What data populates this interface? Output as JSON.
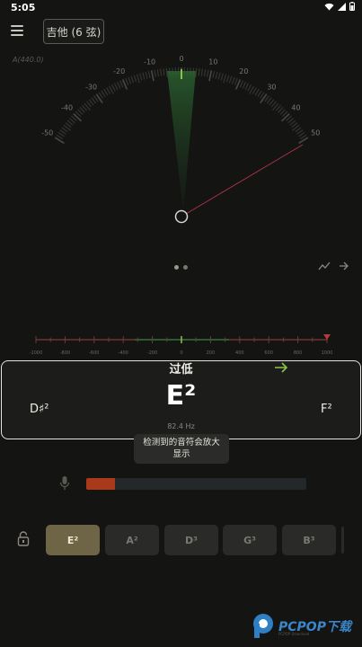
{
  "status_bar": {
    "time": "5:05"
  },
  "header": {
    "instrument": "吉他 (6 弦)",
    "reference": "A(440.0)"
  },
  "gauge": {
    "ticks": [
      "-50",
      "-40",
      "-30",
      "-20",
      "-10",
      "0",
      "10",
      "20",
      "30",
      "40",
      "50"
    ]
  },
  "ruler": {
    "labels": [
      "-1000",
      "-800",
      "-600",
      "-400",
      "-200",
      "0",
      "200",
      "400",
      "600",
      "800",
      "1000"
    ]
  },
  "note_card": {
    "status": "过低",
    "note": "E²",
    "prev_note": "D♯²",
    "next_note": "F²",
    "frequency": "82.4 Hz"
  },
  "toast": {
    "line1": "检测到的音符会放大",
    "line2": "显示"
  },
  "level_meter": {
    "level": 0.13
  },
  "strings": [
    {
      "label": "E²",
      "active": true
    },
    {
      "label": "A²",
      "active": false
    },
    {
      "label": "D³",
      "active": false
    },
    {
      "label": "G³",
      "active": false
    },
    {
      "label": "B³",
      "active": false
    }
  ],
  "watermark": {
    "brand": "PCPOP下载",
    "sub": "PCPOP Download"
  },
  "colors": {
    "accent_green": "#8bc34a",
    "active_string": "#6e6446",
    "meter_fill": "#a83a1a"
  }
}
